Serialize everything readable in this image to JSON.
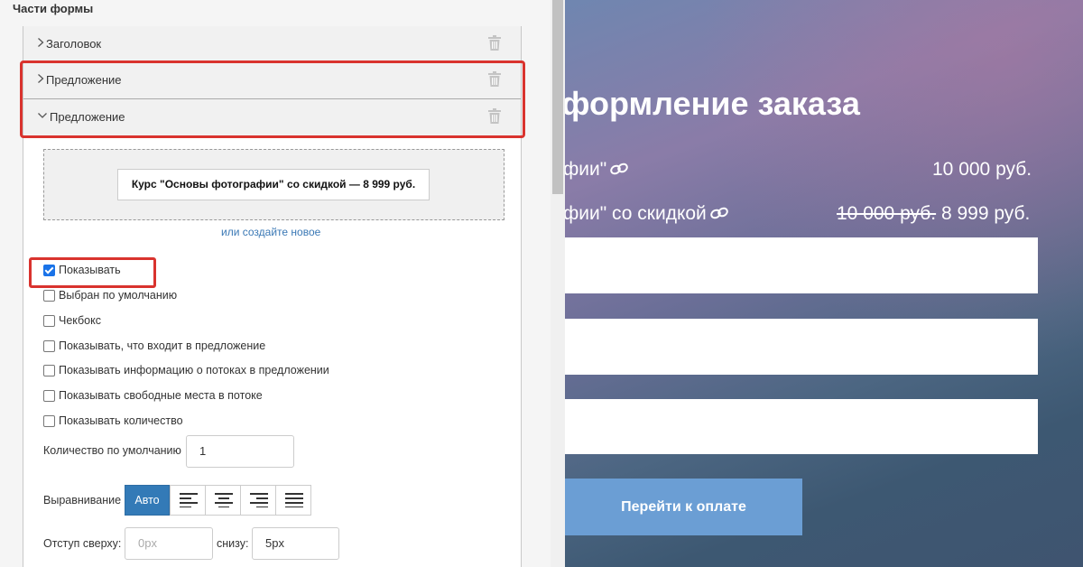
{
  "editor": {
    "section_title": "Части формы",
    "parts": [
      {
        "label": "Заголовок",
        "expanded": false
      },
      {
        "label": "Предложение",
        "expanded": false
      },
      {
        "label": "Предложение",
        "expanded": true
      }
    ],
    "offer_chip": "Курс \"Основы фотографии\" со скидкой — 8 999 руб.",
    "create_new_link": "или создайте новое",
    "checkboxes": [
      {
        "label": "Показывать",
        "checked": true
      },
      {
        "label": "Выбран по умолчанию",
        "checked": false
      },
      {
        "label": "Чекбокс",
        "checked": false
      },
      {
        "label": "Показывать, что входит в предложение",
        "checked": false
      },
      {
        "label": "Показывать информацию о потоках в предложении",
        "checked": false
      },
      {
        "label": "Показывать свободные места в потоке",
        "checked": false
      },
      {
        "label": "Показывать количество",
        "checked": false
      }
    ],
    "default_qty_label": "Количество по умолчанию",
    "default_qty_value": "1",
    "align_label": "Выравнивание",
    "align_auto": "Авто",
    "align_options": [
      "align-left-icon",
      "align-center-icon",
      "align-right-icon",
      "align-justify-icon"
    ],
    "margin_top_label": "Отступ сверху:",
    "margin_top_placeholder": "0px",
    "margin_bottom_label": "снизу:",
    "margin_bottom_value": "5px"
  },
  "preview": {
    "title": "формление заказа",
    "line1_name": "фии\"",
    "line1_price": "10 000 руб.",
    "line2_name": "фии\" со скидкой",
    "line2_old_price": "10 000 руб.",
    "line2_price": " 8 999 руб.",
    "pay_button": "Перейти к оплате"
  },
  "colors": {
    "highlight_red": "#d9332e",
    "primary_blue": "#337ab7",
    "pay_button": "#6b9ed4",
    "link_blue": "#3a78b5"
  }
}
